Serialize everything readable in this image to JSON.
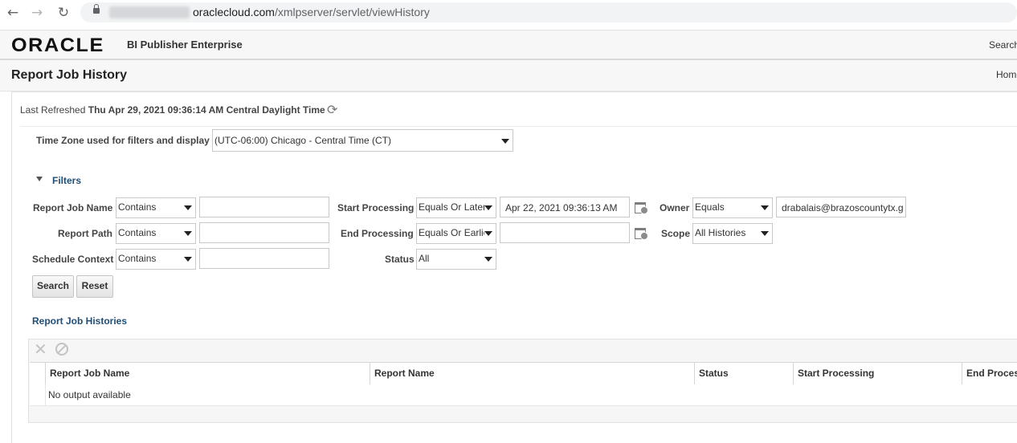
{
  "browser": {
    "url_domain": "oraclecloud.com",
    "url_path": "/xmlpserver/servlet/viewHistory"
  },
  "header": {
    "logo": "ORACLE",
    "product": "BI Publisher Enterprise",
    "search": "Search"
  },
  "page": {
    "title": "Report Job History",
    "home": "Home"
  },
  "refresh": {
    "label": "Last Refreshed",
    "value": "Thu Apr 29, 2021 09:36:14 AM Central Daylight Time"
  },
  "timezone": {
    "label": "Time Zone used for filters and display",
    "value": "(UTC-06:00) Chicago - Central Time (CT)"
  },
  "filters": {
    "title": "Filters",
    "report_job_name": {
      "label": "Report Job Name",
      "operator": "Contains",
      "value": ""
    },
    "report_path": {
      "label": "Report Path",
      "operator": "Contains",
      "value": ""
    },
    "schedule_context": {
      "label": "Schedule Context",
      "operator": "Contains",
      "value": ""
    },
    "start_processing": {
      "label": "Start Processing",
      "operator": "Equals Or Later",
      "value": "Apr 22, 2021 09:36:13 AM"
    },
    "end_processing": {
      "label": "End Processing",
      "operator": "Equals Or Earlier",
      "value": ""
    },
    "status": {
      "label": "Status",
      "value": "All"
    },
    "owner": {
      "label": "Owner",
      "operator": "Equals",
      "value": "drabalais@brazoscountytx.g"
    },
    "scope": {
      "label": "Scope",
      "value": "All Histories"
    },
    "search_button": "Search",
    "reset_button": "Reset"
  },
  "histories": {
    "title": "Report Job Histories",
    "columns": [
      "Report Job Name",
      "Report Name",
      "Status",
      "Start Processing",
      "End Processing"
    ],
    "empty_message": "No output available"
  },
  "colors": {
    "link_blue": "#1f4e79",
    "header_bg": "#f7f7f7"
  }
}
